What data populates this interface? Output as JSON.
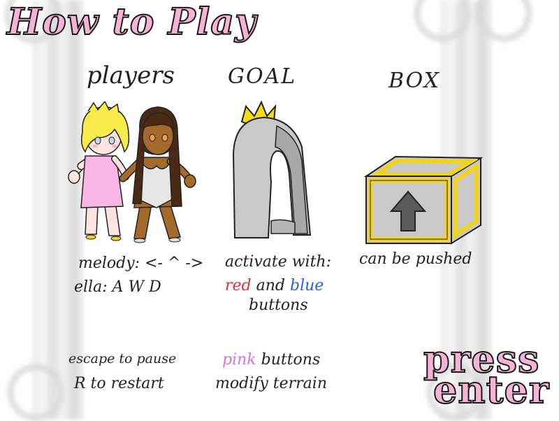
{
  "screen": {
    "title": "How to Play",
    "press_label": "press",
    "enter_label": "enter"
  },
  "sections": {
    "players": {
      "heading": "players",
      "melody": "melody: <- ^ ->",
      "ella": "ella: A W D"
    },
    "goal": {
      "heading": "GOAL",
      "activate": "activate with:",
      "red": "red",
      "and": "and",
      "blue": "blue",
      "buttons": "buttons"
    },
    "box": {
      "heading": "BOX",
      "desc": "can be pushed"
    }
  },
  "footer": {
    "pause": "escape to pause",
    "restart": "R to restart",
    "pink": "pink",
    "buttons": "buttons",
    "modify": "modify terrain"
  },
  "colors": {
    "title_fill": "#f7b3d5",
    "red_word": "#e0303a",
    "blue_word": "#2a5fe0",
    "pink_word": "#e070d8",
    "box_gold": "#f3d21a"
  }
}
